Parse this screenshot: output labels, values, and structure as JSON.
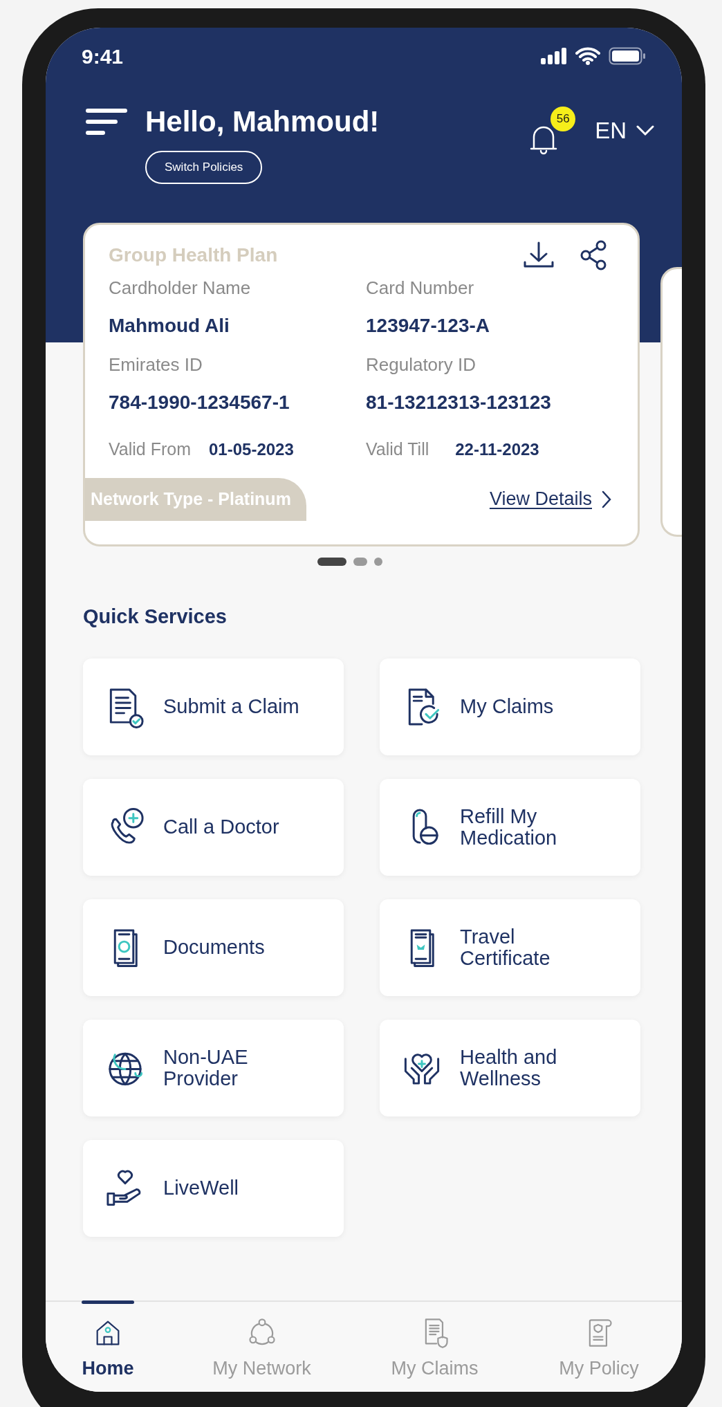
{
  "status_bar": {
    "time": "9:41"
  },
  "header": {
    "greeting": "Hello, Mahmoud!",
    "switch_button": "Switch Policies",
    "notification_count": "56",
    "language": "EN"
  },
  "policy_card": {
    "title": "Group Health Plan",
    "fields": [
      {
        "label": "Cardholder Name",
        "value": "Mahmoud Ali"
      },
      {
        "label": "Card Number",
        "value": "123947-123-A"
      },
      {
        "label": "Emirates ID",
        "value": "784-1990-1234567-1"
      },
      {
        "label": "Regulatory ID",
        "value": "81-13212313-123123"
      }
    ],
    "validity": [
      {
        "label": "Valid From",
        "value": "01-05-2023"
      },
      {
        "label": "Valid Till",
        "value": "22-11-2023"
      }
    ],
    "network_type": "Network Type - Platinum",
    "link": "View Details"
  },
  "pager": [
    {
      "selected": true
    },
    {
      "selected": false
    },
    {
      "selected": false
    }
  ],
  "quick_services": {
    "title": "Quick Services",
    "items": [
      {
        "label": "Submit a Claim",
        "kind": "submit"
      },
      {
        "label": "My Claims",
        "kind": "claims"
      },
      {
        "label": "Call a Doctor",
        "kind": "doctor"
      },
      {
        "label": "Refill My Medication",
        "kind": "pill"
      },
      {
        "label": "Documents",
        "kind": "documents"
      },
      {
        "label": "Travel Certificate",
        "kind": "travel"
      },
      {
        "label": "Non-UAE Provider",
        "kind": "globe"
      },
      {
        "label": "Health and Wellness",
        "kind": "health"
      },
      {
        "label": "LiveWell",
        "kind": "livewell"
      }
    ]
  },
  "tabs": [
    {
      "label": "Home",
      "kind": "home",
      "selected": true
    },
    {
      "label": "My Network",
      "kind": "network",
      "selected": false
    },
    {
      "label": "My Claims",
      "kind": "claims",
      "selected": false
    },
    {
      "label": "My Policy",
      "kind": "policy",
      "selected": false
    }
  ]
}
